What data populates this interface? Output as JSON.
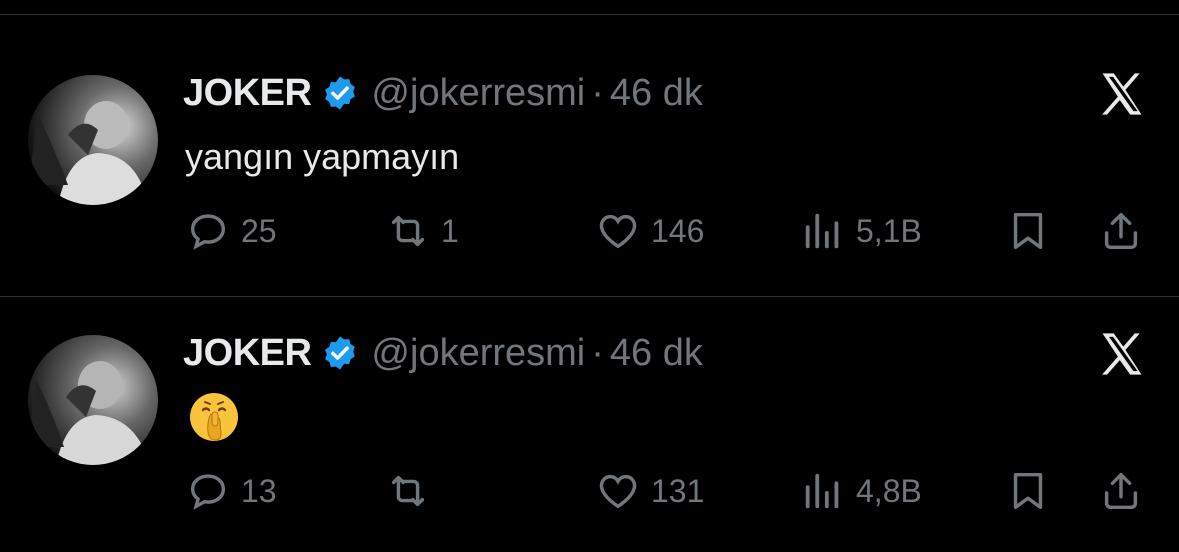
{
  "tweets": [
    {
      "name": "JOKER",
      "handle": "@jokerresmi",
      "separator": "·",
      "time": "46 dk",
      "text": "yangın yapmayın",
      "emoji": null,
      "stats": {
        "replies": "25",
        "retweets": "1",
        "likes": "146",
        "views": "5,1B"
      }
    },
    {
      "name": "JOKER",
      "handle": "@jokerresmi",
      "separator": "·",
      "time": "46 dk",
      "text": "",
      "emoji": "shushing-face",
      "stats": {
        "replies": "13",
        "retweets": "",
        "likes": "131",
        "views": "4,8B"
      }
    }
  ],
  "colors": {
    "background": "#000000",
    "text": "#e7e9ea",
    "muted": "#71767b",
    "verified": "#1d9bf0",
    "divider": "#2f3336"
  },
  "icons": [
    "reply-icon",
    "retweet-icon",
    "like-icon",
    "views-icon",
    "bookmark-icon",
    "share-icon",
    "x-logo-icon",
    "verified-badge-icon"
  ]
}
